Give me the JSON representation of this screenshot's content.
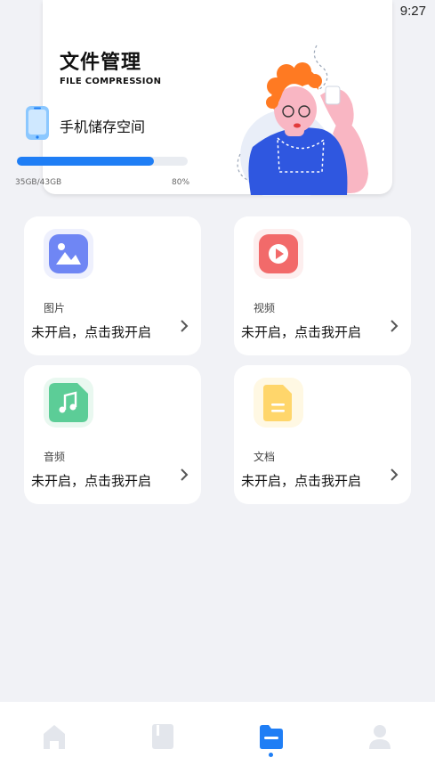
{
  "status_bar": {
    "time": "9:27",
    "icons": [
      "wifi-icon",
      "no-sim-icon",
      "battery-charging-icon"
    ]
  },
  "header": {
    "title": "文件管理",
    "subtitle": "FILE COMPRESSION",
    "storage_label": "手机储存空间",
    "storage_used": "35GB/43GB",
    "storage_percent": "80%",
    "progress": 0.8
  },
  "categories": [
    {
      "label": "图片",
      "status": "未开启，点击我开启",
      "icon": "image-icon",
      "color": "#6f86f4"
    },
    {
      "label": "视频",
      "status": "未开启，点击我开启",
      "icon": "play-icon",
      "color": "#f26a6a"
    },
    {
      "label": "音频",
      "status": "未开启，点击我开启",
      "icon": "music-icon",
      "color": "#5ccd97"
    },
    {
      "label": "文档",
      "status": "未开启，点击我开启",
      "icon": "document-icon",
      "color": "#ffd66b"
    }
  ],
  "bottom_nav": {
    "items": [
      "home-icon",
      "file-icon",
      "folder-icon",
      "user-icon"
    ],
    "active_index": 2,
    "active_color": "#1f7ef5",
    "inactive_color": "#e3e6ec"
  }
}
